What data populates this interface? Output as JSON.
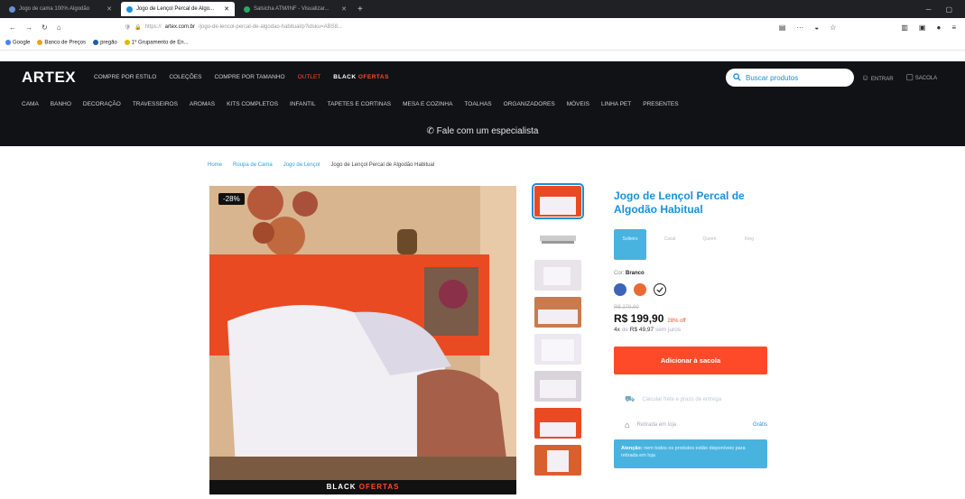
{
  "browser": {
    "tabs": [
      {
        "label": "Jogo de cama 100% Algodão",
        "active": false
      },
      {
        "label": "Jogo de Lençol Percal de Algo...",
        "active": true
      },
      {
        "label": "Salsicha ATM/INF - Visualizar...",
        "active": false
      }
    ],
    "new_tab": "+",
    "url_prefix": "https://",
    "url_domain": "artex.com.br",
    "url_rest": "/jogo-de-lencol-percal-de-algodao-habitual/p?idsku=ABS8...",
    "bookmarks": [
      "Google",
      "Banco de Preços",
      "pregão",
      "1º Grupamento de En..."
    ]
  },
  "site": {
    "logo": "ARTEX",
    "top_menu": [
      "COMPRE POR ESTILO",
      "COLEÇÕES",
      "COMPRE POR TAMANHO",
      "OUTLET"
    ],
    "black_friday_word1": "BLACK",
    "black_friday_word2": "OFERTAS",
    "search_placeholder": "Buscar produtos",
    "account_label": "ENTRAR",
    "bag_label": "SACOLA",
    "category_menu": [
      "CAMA",
      "BANHO",
      "DECORAÇÃO",
      "TRAVESSEIROS",
      "AROMAS",
      "KITS COMPLETOS",
      "INFANTIL",
      "TAPETES E CORTINAS",
      "MESA E COZINHA",
      "TOALHAS",
      "ORGANIZADORES",
      "MÓVEIS",
      "LINHA PET",
      "PRESENTES"
    ],
    "specialist": "Fale com um especialista"
  },
  "breadcrumb": [
    "Home",
    "Roupa de Cama",
    "Jogo de Lençol",
    "Jogo de Lençol Percal de Algodão Habitual"
  ],
  "product": {
    "discount_badge": "-28%",
    "title": "Jogo de Lençol Percal de Algodão Habitual",
    "sizes": [
      {
        "label": "Solteiro",
        "selected": true
      },
      {
        "label": "Casal",
        "selected": false
      },
      {
        "label": "Queen",
        "selected": false
      },
      {
        "label": "King",
        "selected": false
      }
    ],
    "color_label": "Cor:",
    "color_value": "Branco",
    "colors": [
      "#3d64b8",
      "#ea6a34",
      "#ffffff"
    ],
    "old_price": "R$ 279,90",
    "price": "R$ 199,90",
    "off": "28% off",
    "installments_count": "4x",
    "installments_of": "de",
    "installments_value": "R$ 49,97",
    "installments_note": "sem juros",
    "add_to_cart": "Adicionar à sacola",
    "shipping": "Calcular frete e prazo de entrega",
    "store_pickup": "Retirada em loja",
    "store_pickup_tag": "Grátis",
    "alert_title": "Atenção:",
    "alert_text": "nem todos os produtos estão disponíveis para retirada em loja"
  },
  "footer_banner_word1": "BLACK",
  "footer_banner_word2": "OFERTAS"
}
